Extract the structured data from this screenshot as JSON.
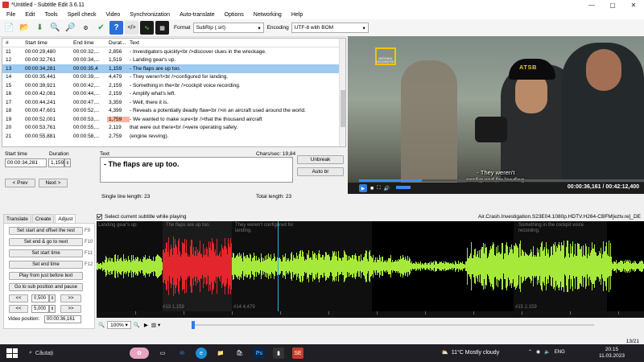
{
  "window": {
    "title": "*Untitled - Subtitle Edit 3.6.11"
  },
  "menu": [
    "File",
    "Edit",
    "Tools",
    "Spell check",
    "Video",
    "Synchronization",
    "Auto-translate",
    "Options",
    "Networking",
    "Help"
  ],
  "toolbar": {
    "format_label": "Format",
    "format_value": "SubRip (.srt)",
    "encoding_label": "Encoding",
    "encoding_value": "UTF-8 with BOM"
  },
  "subtitle_list": {
    "columns": [
      "#",
      "Start time",
      "End time",
      "Durat...",
      "Text"
    ],
    "rows": [
      {
        "num": "11",
        "start": "00:00:29,480",
        "end": "00:00:32,...",
        "dur": "2,856",
        "text": "- Investigators quickly<br />discover clues in the wreckage."
      },
      {
        "num": "12",
        "start": "00:00:32,761",
        "end": "00:00:34,...",
        "dur": "1,519",
        "text": "- Landing gear's up."
      },
      {
        "num": "13",
        "start": "00:00:34,281",
        "end": "00:00:35,4",
        "dur": "1,159",
        "text": "- The flaps are up too.",
        "selected": true
      },
      {
        "num": "14",
        "start": "00:00:35,441",
        "end": "00:00:39,...",
        "dur": "4,479",
        "text": "- They weren't<br />configured for landing."
      },
      {
        "num": "15",
        "start": "00:00:39,921",
        "end": "00:00:42,...",
        "dur": "2,159",
        "text": "- Something in the<br />cockpit voice recording."
      },
      {
        "num": "16",
        "start": "00:00:42,081",
        "end": "00:00:44,...",
        "dur": "2,159",
        "text": "- Amplify what's left."
      },
      {
        "num": "17",
        "start": "00:00:44,241",
        "end": "00:00:47,...",
        "dur": "3,359",
        "text": "- Well, there it is."
      },
      {
        "num": "18",
        "start": "00:00:47,601",
        "end": "00:00:52,...",
        "dur": "4,399",
        "text": "- Reveals a potentially deadly flaw<br />in an aircraft used around the world."
      },
      {
        "num": "19",
        "start": "00:00:52,001",
        "end": "00:00:53,...",
        "dur": "1,759",
        "text": "- We wanted to make sure<br />that the thousand aircraft",
        "warn": true
      },
      {
        "num": "20",
        "start": "00:00:53,761",
        "end": "00:00:55,...",
        "dur": "2,119",
        "text": "that were out there<br />were operating safely."
      },
      {
        "num": "21",
        "start": "00:00:55,881",
        "end": "00:00:58,...",
        "dur": "2,759",
        "text": "(engine revving)."
      }
    ]
  },
  "editor": {
    "start_label": "Start time",
    "start_value": "00:00:34,281",
    "duration_label": "Duration",
    "duration_value": "1,159",
    "text_label": "Text",
    "text_value": "- The flaps are up too.",
    "chars_sec": "Chars/sec: 19,84",
    "single_line": "Single line length: 23",
    "total_length": "Total length: 23",
    "prev": "< Prev",
    "next": "Next >",
    "unbreak": "Unbreak",
    "auto_br": "Auto br"
  },
  "video": {
    "subtitle_line1": "- They weren't",
    "subtitle_line2": "configured for landing.",
    "time": "00:00:36,161 / 00:42:12,400",
    "progress": 0.22,
    "logo": "NATIONAL GEOGRAPHIC",
    "cap_text": "ATSB"
  },
  "tabs": [
    "Translate",
    "Create",
    "Adjust"
  ],
  "adjust_panel": {
    "buttons": [
      {
        "label": "Set start and offset the rest",
        "key": "F9"
      },
      {
        "label": "Set end & go to next",
        "key": "F10"
      },
      {
        "label": "Set start time",
        "key": "F11"
      },
      {
        "label": "Set end time",
        "key": "F12"
      },
      {
        "label": "Play from just before text",
        "key": ""
      },
      {
        "label": "Go to sub position and pause",
        "key": ""
      }
    ],
    "step1": "0,500",
    "step2": "5,000",
    "rew": "<<",
    "fwd": ">>",
    "video_position_label": "Video position:",
    "video_position_value": "00:00:36,161"
  },
  "select_current": "Select current subtitle while playing",
  "filename": "Air.Crash.Investigation.S23E04.1080p.HDTV.H264-CBFM[eztv.re]_DE",
  "waveform": {
    "segments": [
      {
        "label": "Landing gear's up.",
        "foot": ""
      },
      {
        "label": "The flaps are up too.",
        "foot": "#13  1,159"
      },
      {
        "label": "They weren't configured for landing.",
        "foot": "#14  4,479"
      },
      {
        "label": "Something in the cockpit voice recording.",
        "foot": "#15  2,159"
      }
    ]
  },
  "zoom": {
    "value": "100%"
  },
  "page_count": "13/21",
  "taskbar": {
    "search": "Căutați",
    "weather": "11°C  Mostly cloudy",
    "lang": "ENG",
    "time": "20:15",
    "date": "11.03.2023"
  },
  "colors": {
    "selected_row": "#9fcaf0",
    "wave_green": "#a6e93a",
    "wave_red": "#e3252d",
    "accent": "#2b7de9"
  }
}
